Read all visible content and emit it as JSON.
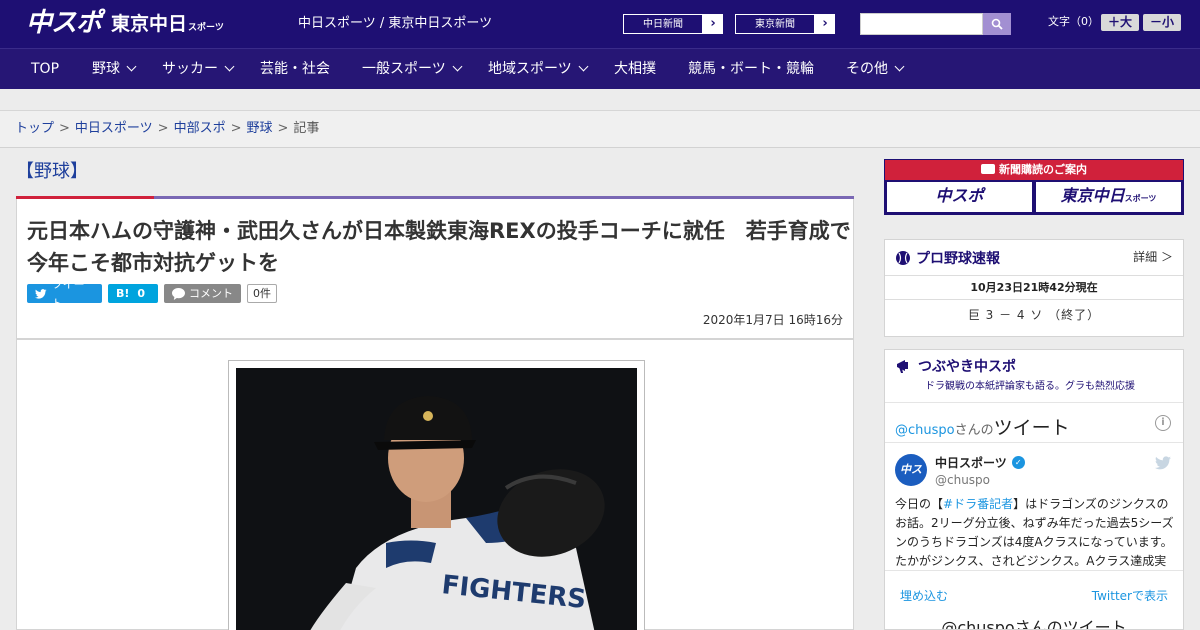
{
  "header": {
    "logo_main": "中スポ",
    "logo_sub": "東京中日",
    "logo_sub_small": "スポーツ",
    "site_names": "中日スポーツ / 東京中日スポーツ",
    "ext_links": [
      {
        "label": "中日新聞",
        "arrow": "›"
      },
      {
        "label": "東京新聞",
        "arrow": "›"
      }
    ],
    "search_placeholder": "",
    "font_label": "文字（0）",
    "font_bigger": "＋大",
    "font_smaller": "－小"
  },
  "nav": [
    {
      "label": "TOP",
      "dropdown": false
    },
    {
      "label": "野球",
      "dropdown": true
    },
    {
      "label": "サッカー",
      "dropdown": true
    },
    {
      "label": "芸能・社会",
      "dropdown": false
    },
    {
      "label": "一般スポーツ",
      "dropdown": true
    },
    {
      "label": "地域スポーツ",
      "dropdown": true
    },
    {
      "label": "大相撲",
      "dropdown": false
    },
    {
      "label": "競馬・ボート・競輪",
      "dropdown": false
    },
    {
      "label": "その他",
      "dropdown": true
    }
  ],
  "breadcrumb": [
    "トップ",
    "中日スポーツ",
    "中部スポ",
    "野球",
    "記事"
  ],
  "category": "【野球】",
  "article": {
    "headline": "元日本ハムの守護神・武田久さんが日本製鉄東海REXの投手コーチに就任　若手育成で今年こそ都市対抗ゲットを",
    "tweet_label": "ツイート",
    "hatena_label": "B!",
    "hatena_count": "0",
    "comment_label": "コメント",
    "comment_count": "0件",
    "date": "2020年1月7日 16時16分"
  },
  "sidebar": {
    "subscription_head": "新聞購読のご案内",
    "sub_logo_1": "中スポ",
    "sub_logo_2": "東京中日",
    "sub_logo_2_small": "スポーツ",
    "score_title": "プロ野球速報",
    "score_detail": "詳細 ＞",
    "score_time": "10月23日21時42分現在",
    "score_line": "巨 3 － 4 ソ （終了）",
    "tweet_box_title": "つぶやき中スポ",
    "tweet_box_sub": "ドラ観戦の本紙評論家も語る。グラも熱烈応援",
    "tw_head_user": "@chuspo",
    "tw_head_san": "さんの",
    "tw_head_tweet": "ツイート",
    "tw_avatar": "中スポ",
    "tw_name": "中日スポーツ",
    "tw_handle": "@chuspo",
    "tw_text_pre": "今日の【",
    "tw_text_tag": "#ドラ番記者",
    "tw_text_post": "】はドラゴンズのジンクスのお話。2リーグ分立後、ねずみ年だった過去5シーズンのうちドラゴンズは4度Aクラスになっています。たかがジンクス、されどジンクス。Aクラス達成実",
    "tw_embed": "埋め込む",
    "tw_view": "Twitterで表示",
    "tw_next": "@chuspoさんのツイート"
  },
  "colors": {
    "header_bg": "#1e0f73",
    "nav_bg": "#261675",
    "accent_red": "#d0213b",
    "accent_purple": "#7a68b4",
    "link": "#1e3f9c",
    "twitter": "#1b95e0"
  }
}
